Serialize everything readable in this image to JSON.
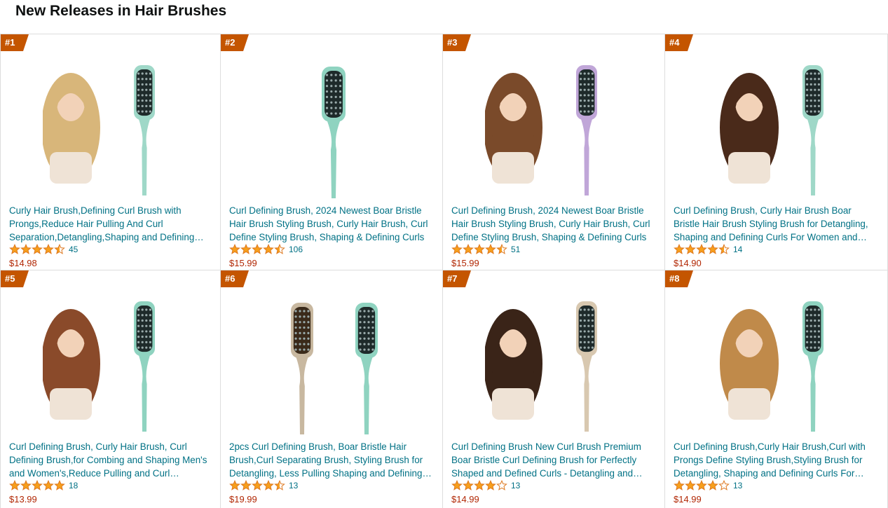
{
  "page": {
    "title": "New Releases in Hair Brushes"
  },
  "colors": {
    "rank_badge": "#C45500",
    "link": "#007185",
    "price": "#B12704",
    "star": "#F79F1B"
  },
  "products": [
    {
      "rank": "#1",
      "title": "Curly Hair Brush,Defining Curl Brush with Prongs,Reduce Hair Pulling And Curl Separation,Detangling,Shaping and Defining Curls",
      "rating": 4.5,
      "reviews": "45",
      "price": "$14.98",
      "image": {
        "brush_color": "#9fd8c8",
        "model": "blonde-waves",
        "hair_color": "#d8b67a"
      }
    },
    {
      "rank": "#2",
      "title": "Curl Defining Brush, 2024 Newest Boar Bristle Hair Brush Styling Brush, Curly Hair Brush, Curl Define Styling Brush, Shaping & Defining Curls",
      "rating": 4.5,
      "reviews": "106",
      "price": "$15.99",
      "image": {
        "brush_color": "#8fd3c0",
        "model": "none",
        "hair_color": ""
      }
    },
    {
      "rank": "#3",
      "title": "Curl Defining Brush, 2024 Newest Boar Bristle Hair Brush Styling Brush, Curly Hair Brush, Curl Define Styling Brush, Shaping & Defining Curls",
      "rating": 4.5,
      "reviews": "51",
      "price": "$15.99",
      "image": {
        "brush_color": "#c0a6d8",
        "model": "brunette-back",
        "hair_color": "#7a4a2a"
      }
    },
    {
      "rank": "#4",
      "title": "Curl Defining Brush, Curly Hair Brush Boar Bristle Hair Brush Styling Brush for Detangling, Shaping and Defining Curls For Women and Men",
      "rating": 4.5,
      "reviews": "14",
      "price": "$14.90",
      "image": {
        "brush_color": "#9fd8c8",
        "model": "brunette-curls",
        "hair_color": "#4a2a1a"
      }
    },
    {
      "rank": "#5",
      "title": "Curl Defining Brush, Curly Hair Brush, Curl Defining Brush,for Combing and Shaping Men's and Women's,Reduce Pulling and Curl Separation",
      "rating": 5,
      "reviews": "18",
      "price": "$13.99",
      "image": {
        "brush_color": "#8fd3c0",
        "model": "auburn-curls",
        "hair_color": "#8a4a2a"
      }
    },
    {
      "rank": "#6",
      "title": "2pcs Curl Defining Brush, Boar Bristle Hair Brush,Curl Separating Brush, Styling Brush for Detangling, Less Pulling Shaping and Defining Curls",
      "rating": 4.5,
      "reviews": "13",
      "price": "$19.99",
      "image": {
        "brush_color": "#8fd3c0",
        "model": "none",
        "hair_color": ""
      }
    },
    {
      "rank": "#7",
      "title": "Curl Defining Brush New Curl Brush Premium Boar Bristle Curl Defining Brush for Perfectly Shaped and Defined Curls - Detangling and Styling",
      "rating": 4,
      "reviews": "13",
      "price": "$14.99",
      "image": {
        "brush_color": "#d8c8b0",
        "model": "dark-curls",
        "hair_color": "#3a2418"
      }
    },
    {
      "rank": "#8",
      "title": "Curl Defining Brush,Curly Hair Brush,Curl with Prongs Define Styling Brush,Styling Brush for Detangling, Shaping and Defining Curls For Women",
      "rating": 4,
      "reviews": "13",
      "price": "$14.99",
      "image": {
        "brush_color": "#8fd3c0",
        "model": "honey-waves",
        "hair_color": "#c08a4a"
      }
    }
  ]
}
